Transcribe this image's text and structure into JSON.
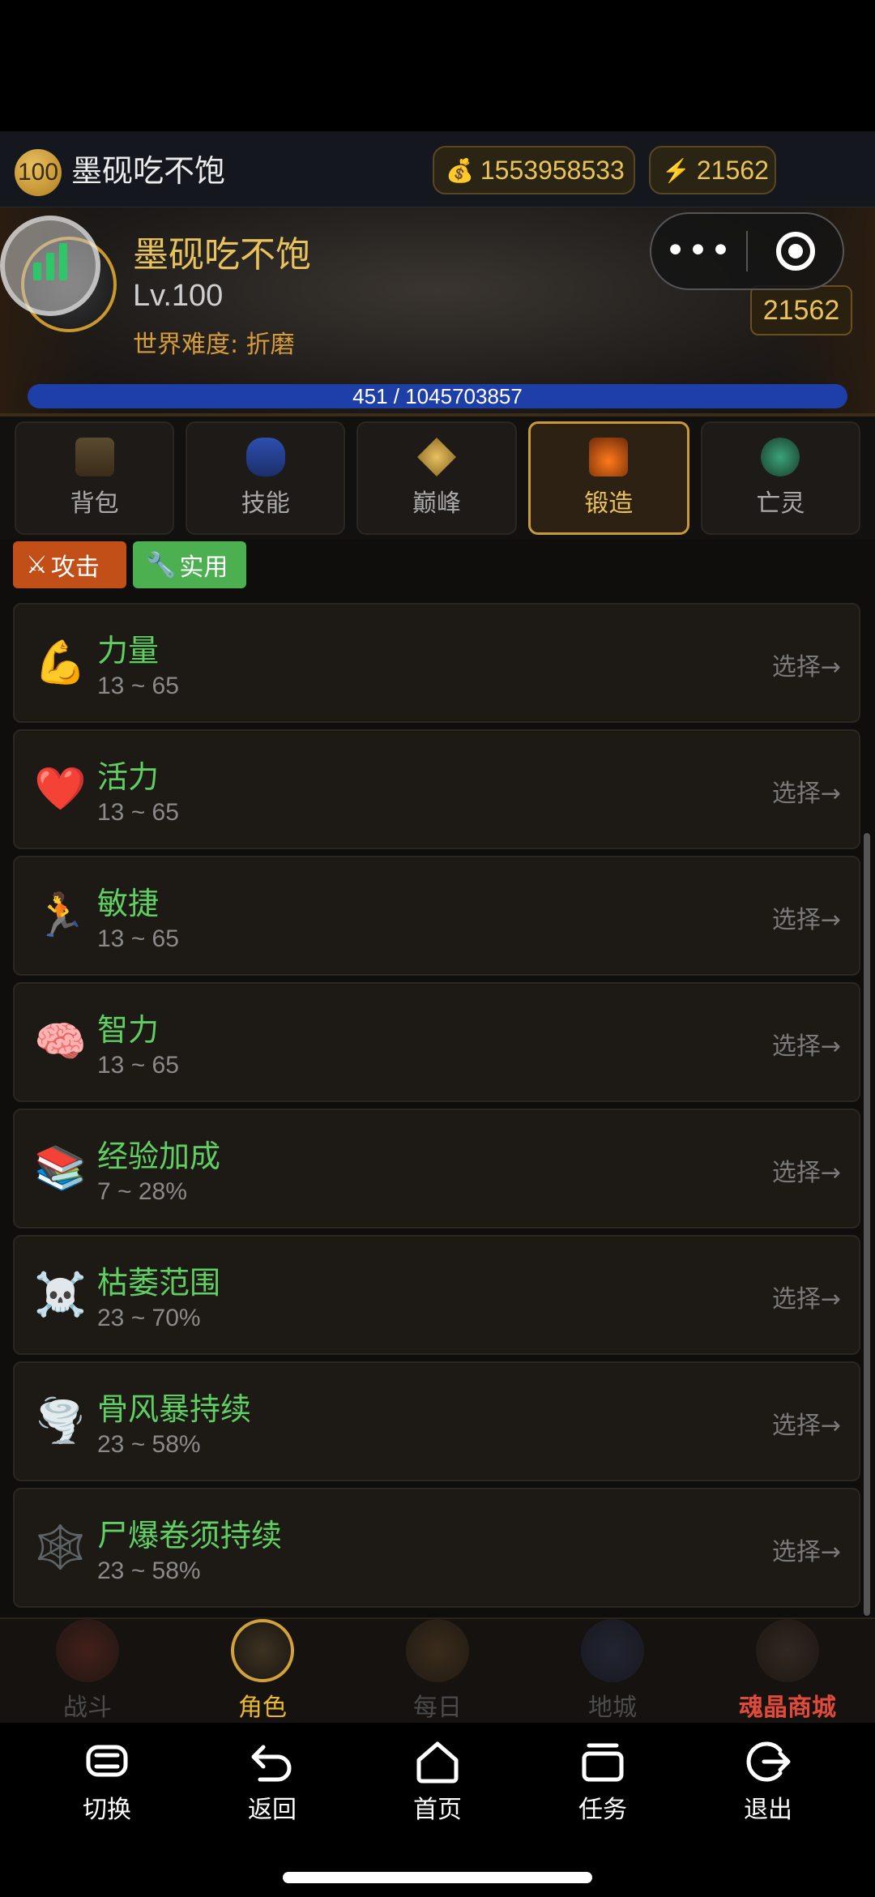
{
  "topbar": {
    "level": "100",
    "player_name": "墨砚吃不饱",
    "gold": "1553958533",
    "energy": "21562",
    "gold_icon": "money-bag-icon",
    "energy_icon": "lightning-icon"
  },
  "hero": {
    "name": "墨砚吃不饱",
    "level": "Lv.100",
    "difficulty": "世界难度: 折磨",
    "energy": "21562",
    "xp_text": "451 / 1045703857",
    "xp_current": 451,
    "xp_max": 1045703857
  },
  "capsule": {
    "more": "•••"
  },
  "tabs": [
    {
      "label": "背包"
    },
    {
      "label": "技能"
    },
    {
      "label": "巅峰"
    },
    {
      "label": "锻造"
    },
    {
      "label": "亡灵"
    }
  ],
  "active_tab": "锻造",
  "filters": {
    "attack": "攻击",
    "utility": "实用",
    "active": "实用"
  },
  "options": [
    {
      "name": "力量",
      "range": "13 ~ 65",
      "select": "选择→",
      "icon": "💪"
    },
    {
      "name": "活力",
      "range": "13 ~ 65",
      "select": "选择→",
      "icon": "❤️"
    },
    {
      "name": "敏捷",
      "range": "13 ~ 65",
      "select": "选择→",
      "icon": "🏃"
    },
    {
      "name": "智力",
      "range": "13 ~ 65",
      "select": "选择→",
      "icon": "🧠"
    },
    {
      "name": "经验加成",
      "range": "7 ~ 28%",
      "select": "选择→",
      "icon": "📚"
    },
    {
      "name": "枯萎范围",
      "range": "23 ~ 70%",
      "select": "选择→",
      "icon": "☠️"
    },
    {
      "name": "骨风暴持续",
      "range": "23 ~ 58%",
      "select": "选择→",
      "icon": "🌪️"
    },
    {
      "name": "尸爆卷须持续",
      "range": "23 ~ 58%",
      "select": "选择→",
      "icon": "🕸️"
    }
  ],
  "game_nav": [
    {
      "label": "战斗"
    },
    {
      "label": "角色"
    },
    {
      "label": "每日"
    },
    {
      "label": "地城"
    },
    {
      "label": "魂晶商城"
    }
  ],
  "active_game_nav": "角色",
  "system_nav": [
    {
      "label": "切换"
    },
    {
      "label": "返回"
    },
    {
      "label": "首页"
    },
    {
      "label": "任务"
    },
    {
      "label": "退出"
    }
  ],
  "colors": {
    "accent_gold": "#e9c25a",
    "option_green": "#5fcf62",
    "xp_blue": "#1f3fa8",
    "shop_red": "#e04a3a",
    "attack_chip": "#c24e18",
    "util_chip": "#4caf50"
  }
}
